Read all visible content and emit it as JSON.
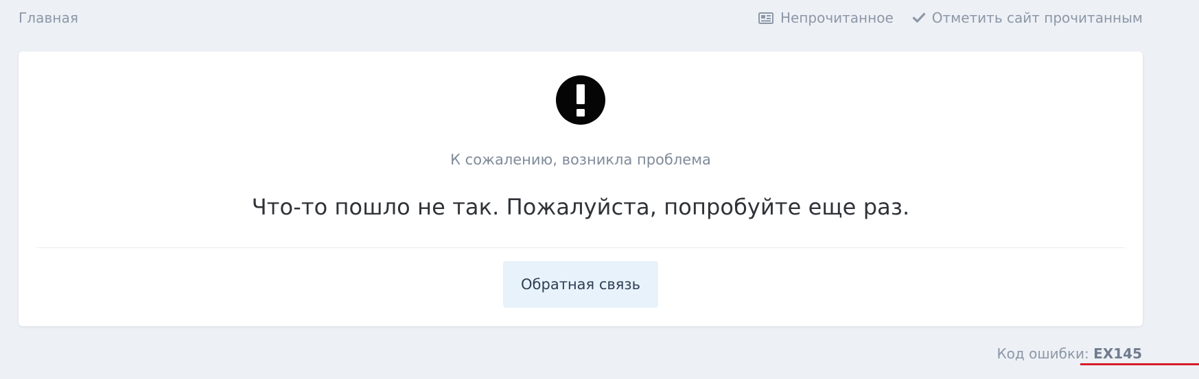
{
  "topbar": {
    "breadcrumb": "Главная",
    "unread_label": "Непрочитанное",
    "mark_read_label": "Отметить сайт прочитанным",
    "unread_icon": "newspaper-icon",
    "mark_read_icon": "check-icon"
  },
  "error": {
    "icon": "exclamation-circle-icon",
    "subtitle": "К сожалению, возникла проблема",
    "message": "Что-то пошло не так. Пожалуйста, попробуйте еще раз.",
    "feedback_button": "Обратная связь",
    "code_label": "Код ошибки:",
    "code_value": "EX145"
  },
  "colors": {
    "background": "#edf0f5",
    "card": "#ffffff",
    "button_bg": "#e8f2fb",
    "muted_text": "#8c97a6",
    "annotation_red": "#d81b2a"
  }
}
